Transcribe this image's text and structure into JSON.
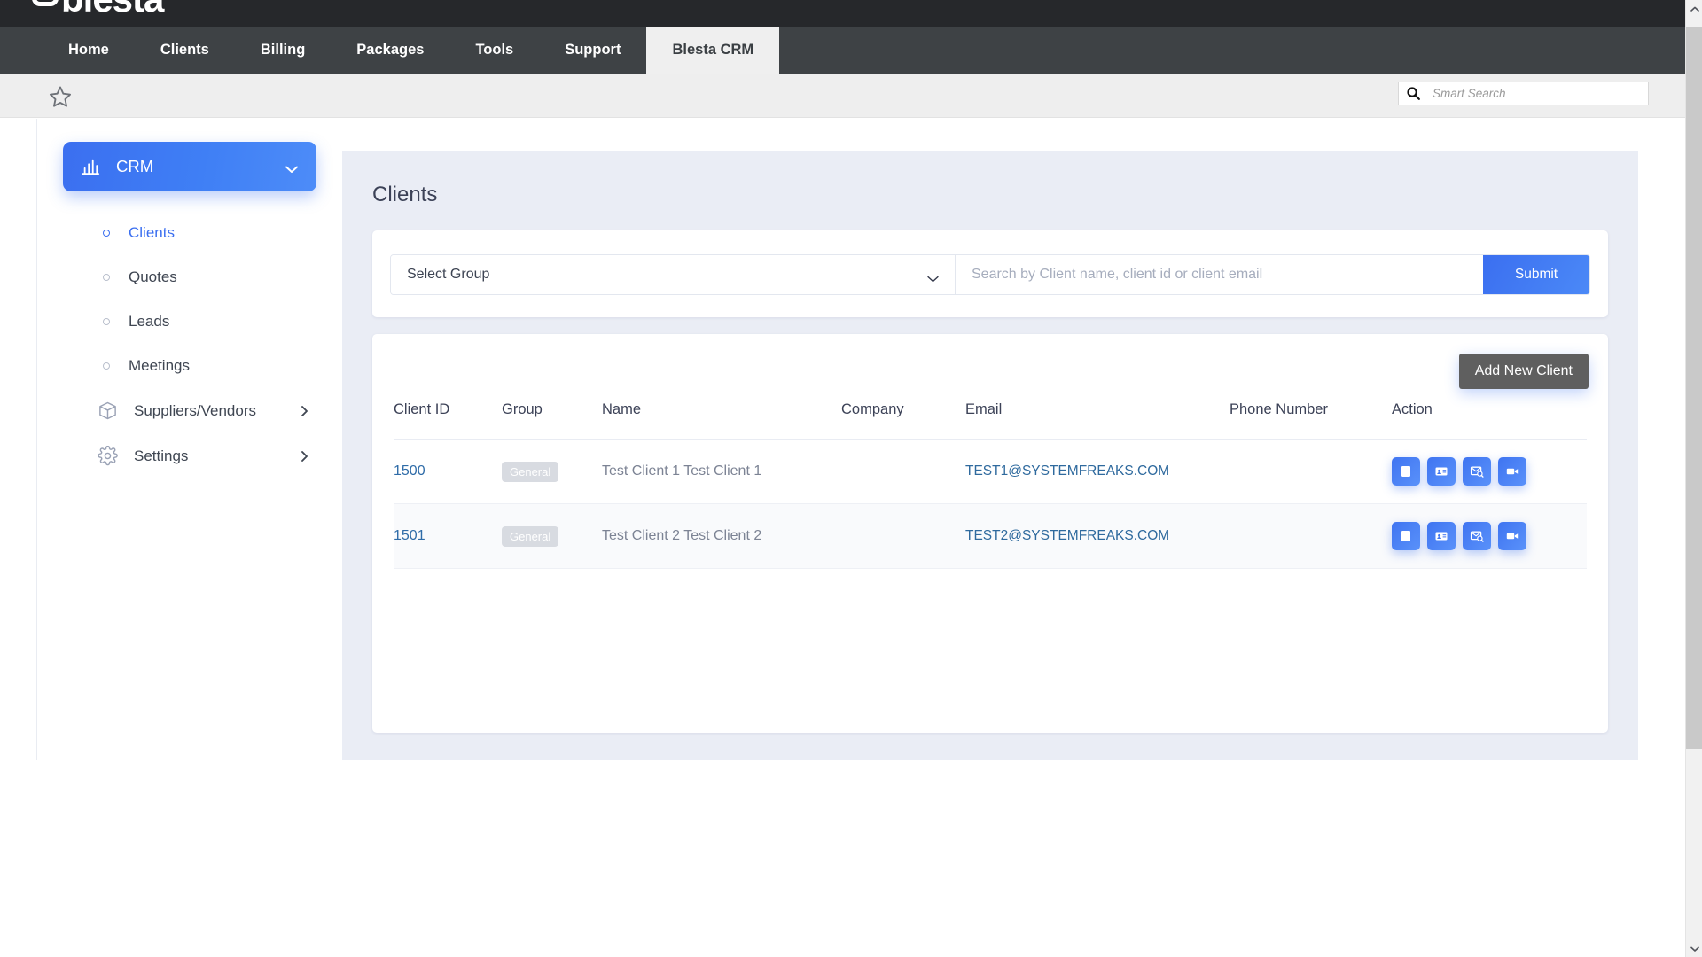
{
  "brand": {
    "logo_text": "blesta"
  },
  "topnav": {
    "items": [
      {
        "label": "Home",
        "active": false
      },
      {
        "label": "Clients",
        "active": false
      },
      {
        "label": "Billing",
        "active": false
      },
      {
        "label": "Packages",
        "active": false
      },
      {
        "label": "Tools",
        "active": false
      },
      {
        "label": "Support",
        "active": false
      },
      {
        "label": "Blesta CRM",
        "active": true
      }
    ]
  },
  "subbar": {
    "bookmark_icon": "star-icon",
    "search": {
      "placeholder": "Smart Search",
      "value": "",
      "icon": "search-icon"
    }
  },
  "sidebar": {
    "section": {
      "label": "CRM",
      "icon": "bar-chart-icon",
      "chevron": "chevron-down-icon"
    },
    "items": [
      {
        "label": "Clients",
        "active": true
      },
      {
        "label": "Quotes",
        "active": false
      },
      {
        "label": "Leads",
        "active": false
      },
      {
        "label": "Meetings",
        "active": false
      }
    ],
    "groups": [
      {
        "label": "Suppliers/Vendors",
        "icon": "box-icon",
        "chevron": "chevron-right-icon"
      },
      {
        "label": "Settings",
        "icon": "gear-icon",
        "chevron": "chevron-right-icon"
      }
    ]
  },
  "main": {
    "title": "Clients",
    "filter": {
      "group_select": {
        "value": "Select Group",
        "chevron": "chevron-down-icon"
      },
      "search": {
        "placeholder": "Search by Client name, client id or client email",
        "value": ""
      },
      "submit_label": "Submit"
    },
    "add_client_label": "Add New Client",
    "table": {
      "columns": [
        "Client ID",
        "Group",
        "Name",
        "Company",
        "Email",
        "Phone Number",
        "Action"
      ],
      "rows": [
        {
          "client_id": "1500",
          "group": "General",
          "name": "Test Client 1 Test Client 1",
          "company": "",
          "email": "TEST1@SYSTEMFREAKS.COM",
          "phone": "",
          "actions": [
            "note-icon",
            "contact-card-icon",
            "email-search-icon",
            "video-camera-icon"
          ]
        },
        {
          "client_id": "1501",
          "group": "General",
          "name": "Test Client 2 Test Client 2",
          "company": "",
          "email": "TEST2@SYSTEMFREAKS.COM",
          "phone": "",
          "actions": [
            "note-icon",
            "contact-card-icon",
            "email-search-icon",
            "video-camera-icon"
          ]
        }
      ]
    }
  },
  "colors": {
    "accent_blue": "#3b6ff0",
    "nav_dark": "#3e4245",
    "brand_dark": "#26282b",
    "content_bg": "#eaedf5",
    "link_blue": "#2f6ca8",
    "badge_gray": "#d8dbe1",
    "add_button_gray": "#5f5f5f"
  }
}
